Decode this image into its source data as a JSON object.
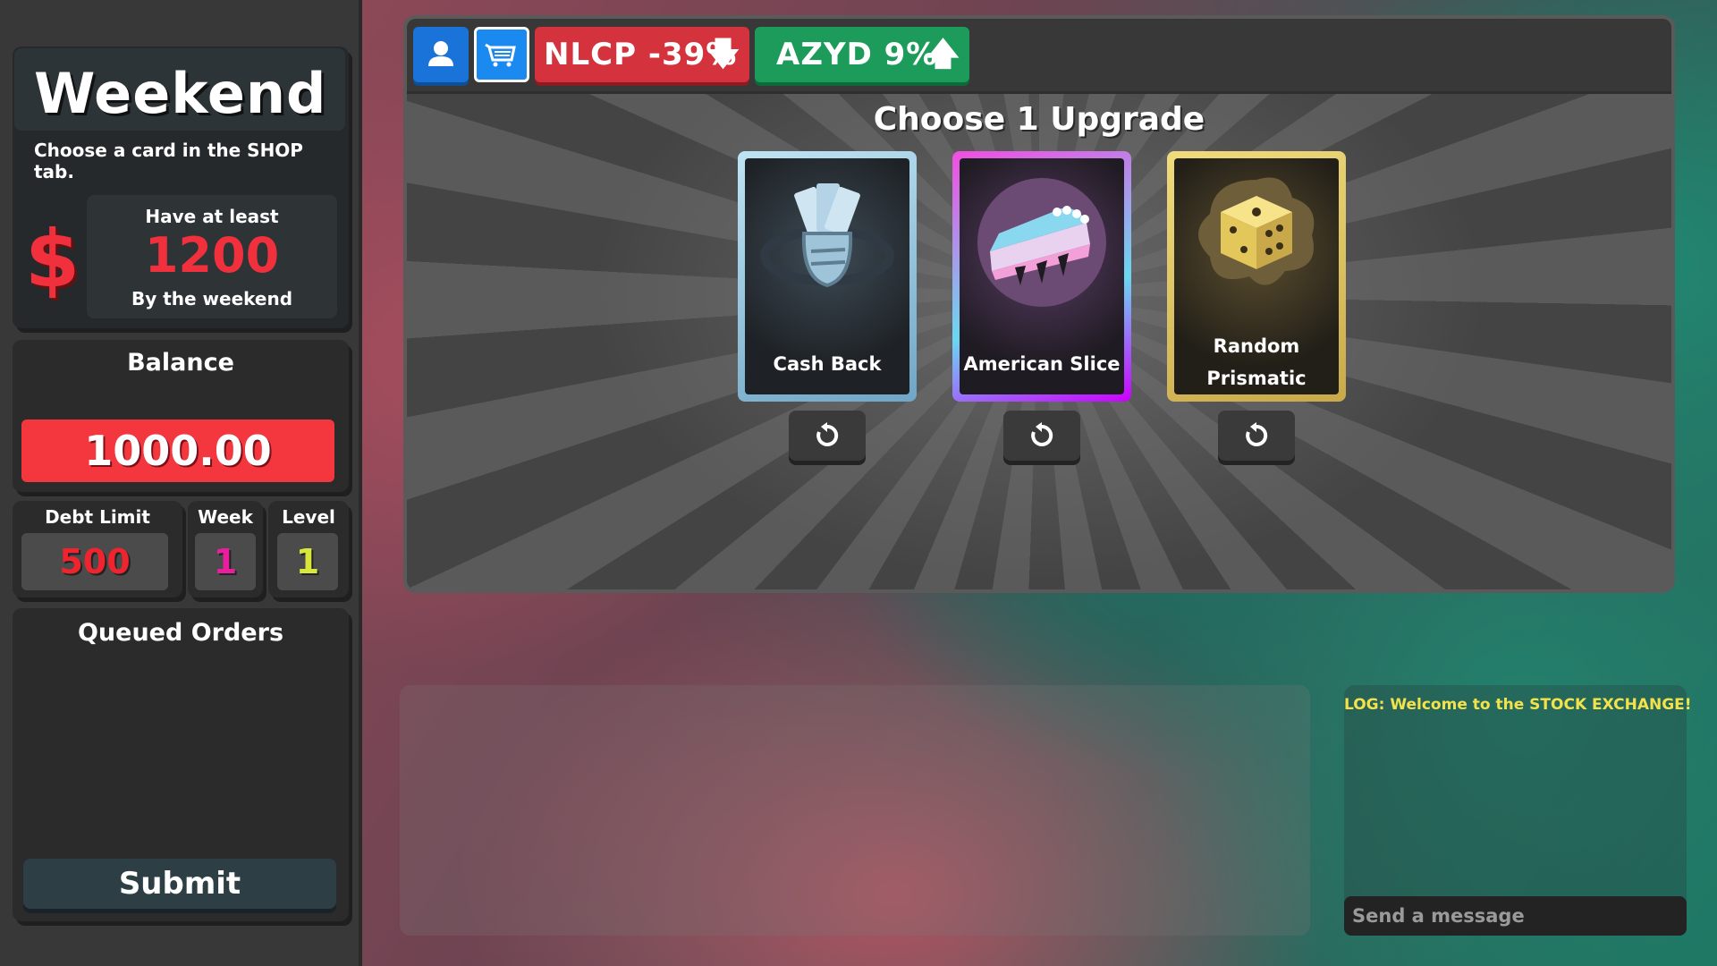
{
  "goal": {
    "title": "Weekend",
    "subtitle": "Choose a card in the SHOP tab.",
    "currency_symbol": "$",
    "line1": "Have at least",
    "amount": "1200",
    "line3": "By the weekend"
  },
  "balance": {
    "label": "Balance",
    "value": "1000.00"
  },
  "stats": {
    "debt_limit": {
      "label": "Debt Limit",
      "value": "500"
    },
    "week": {
      "label": "Week",
      "value": "1"
    },
    "level": {
      "label": "Level",
      "value": "1"
    }
  },
  "orders": {
    "label": "Queued Orders",
    "submit_label": "Submit"
  },
  "tabs": [
    {
      "name": "profile",
      "icon": "user-icon"
    },
    {
      "name": "shop",
      "icon": "cart-icon",
      "active": true
    }
  ],
  "tickers": [
    {
      "label": "NLCP -39%",
      "direction": "down",
      "arrow": "🡇",
      "color": "#d4323c"
    },
    {
      "label": "AZYD 9%",
      "direction": "up",
      "arrow": "🡅",
      "color": "#1c9b5a"
    }
  ],
  "shop": {
    "title": "Choose 1 Upgrade",
    "cards": [
      {
        "label": "Cash Back",
        "icon": "cash-fist-icon",
        "rarity_color": "#bfe4f4"
      },
      {
        "label": "American Slice",
        "icon": "pie-slice-icon",
        "rarity_color": "#f24de0"
      },
      {
        "label_line1": "Random",
        "label_line2": "Prismatic",
        "icon": "dice-icon",
        "rarity_color": "#f0dc7d"
      }
    ],
    "reroll_icon": "reroll-icon"
  },
  "log": {
    "message": "LOG: Welcome to the STOCK EXCHANGE!",
    "input_placeholder": "Send a message"
  }
}
